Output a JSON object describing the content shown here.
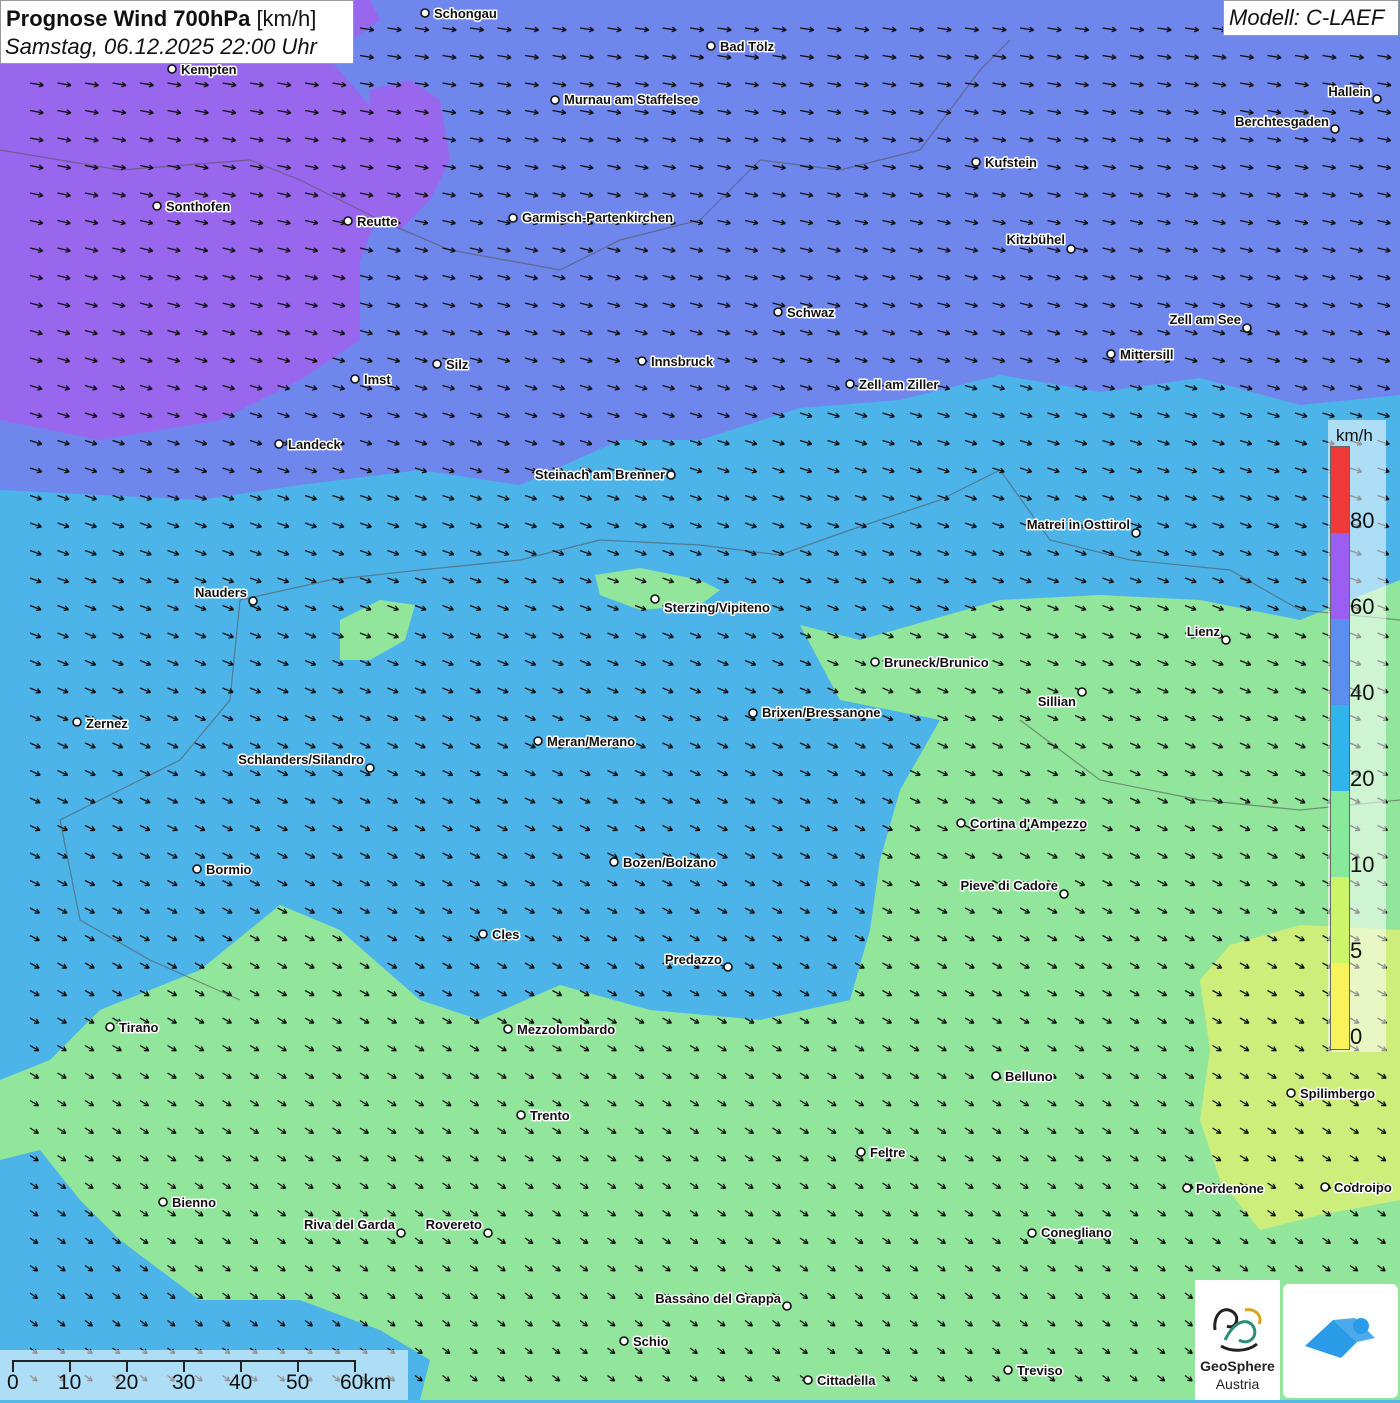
{
  "title": {
    "main_bold": "Prognose Wind 700hPa",
    "main_unit": "[km/h]",
    "datetime": "Samstag, 06.12.2025 22:00 Uhr"
  },
  "model_label": "Modell: C-LAEF",
  "legend": {
    "unit": "km/h",
    "ticks": [
      "80",
      "60",
      "40",
      "20",
      "10",
      "5",
      "0"
    ],
    "colors": [
      "#f03a3a",
      "#9b5ef2",
      "#5c8ef0",
      "#2fb5ec",
      "#86ea9a",
      "#cdf56a",
      "#f8f35a"
    ]
  },
  "scale": {
    "labels": [
      "0",
      "10",
      "20",
      "30",
      "40",
      "50",
      "60km"
    ]
  },
  "logos": {
    "geosphere_line1": "GeoSphere",
    "geosphere_line2": "Austria"
  },
  "colors": {
    "purple": "#9966ee",
    "blue_purple": "#6f86ec",
    "sky": "#4db4ea",
    "green": "#92e69c",
    "yellow_green": "#cdee7a"
  },
  "cities": [
    {
      "name": "Schongau"
    },
    {
      "name": "Bad Tölz"
    },
    {
      "name": "Kempten"
    },
    {
      "name": "Murnau am Staffelsee"
    },
    {
      "name": "Hallein"
    },
    {
      "name": "Berchtesgaden"
    },
    {
      "name": "Kufstein"
    },
    {
      "name": "Sonthofen"
    },
    {
      "name": "Reutte"
    },
    {
      "name": "Garmisch-Partenkirchen"
    },
    {
      "name": "Kitzbühel"
    },
    {
      "name": "Schwaz"
    },
    {
      "name": "Zell am See"
    },
    {
      "name": "Innsbruck"
    },
    {
      "name": "Mittersill"
    },
    {
      "name": "Silz"
    },
    {
      "name": "Imst"
    },
    {
      "name": "Zell am Ziller"
    },
    {
      "name": "Landeck"
    },
    {
      "name": "Steinach am Brenner"
    },
    {
      "name": "Matrei in Osttirol"
    },
    {
      "name": "Nauders"
    },
    {
      "name": "Sterzing/Vipiteno"
    },
    {
      "name": "Lienz"
    },
    {
      "name": "Bruneck/Brunico"
    },
    {
      "name": "Sillian"
    },
    {
      "name": "Brixen/Bressanone"
    },
    {
      "name": "Zernez"
    },
    {
      "name": "Meran/Merano"
    },
    {
      "name": "Schlanders/Silandro"
    },
    {
      "name": "Cortina d'Ampezzo"
    },
    {
      "name": "Bozen/Bolzano"
    },
    {
      "name": "Bormio"
    },
    {
      "name": "Pieve di Cadore"
    },
    {
      "name": "Cles"
    },
    {
      "name": "Predazzo"
    },
    {
      "name": "Tirano"
    },
    {
      "name": "Mezzolombardo"
    },
    {
      "name": "Belluno"
    },
    {
      "name": "Spilimbergo"
    },
    {
      "name": "Trento"
    },
    {
      "name": "Feltre"
    },
    {
      "name": "Bienno"
    },
    {
      "name": "Pordenone"
    },
    {
      "name": "Codroipo"
    },
    {
      "name": "Riva del Garda"
    },
    {
      "name": "Rovereto"
    },
    {
      "name": "Conegliano"
    },
    {
      "name": "Bassano del Grappa"
    },
    {
      "name": "Schio"
    },
    {
      "name": "Treviso"
    },
    {
      "name": "Cittadella"
    }
  ]
}
